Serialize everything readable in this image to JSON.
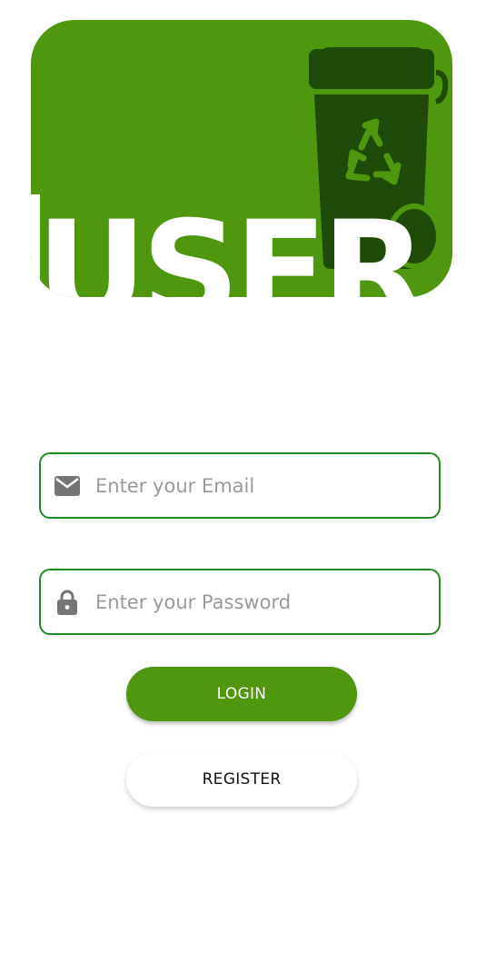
{
  "banner": {
    "logo_text": "USER",
    "bg_color": "#4f970f",
    "bin_color": "#1f4a07"
  },
  "email_field": {
    "icon": "mail-icon",
    "placeholder": "Enter your Email",
    "value": ""
  },
  "password_field": {
    "icon": "lock-icon",
    "placeholder": "Enter your Password",
    "value": ""
  },
  "buttons": {
    "login_label": "LOGIN",
    "register_label": "REGISTER"
  },
  "colors": {
    "accent": "#4f970f",
    "field_border": "#1f8a1f"
  }
}
